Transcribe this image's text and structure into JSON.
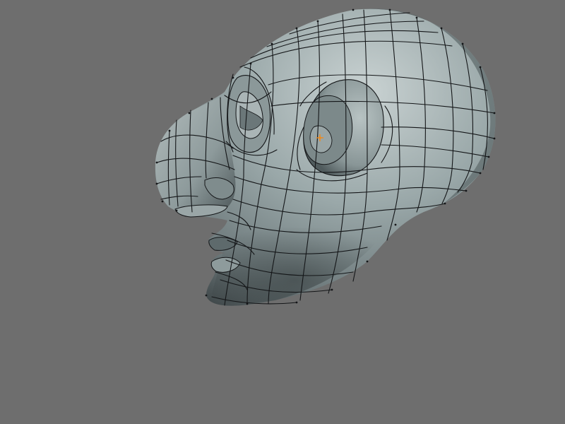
{
  "viewport": {
    "background": "#6e6e6e",
    "mesh_color": "#8c9a9b",
    "shadow_color": "#3f4749",
    "highlight_color": "#c5cfcf",
    "wire_color": "#141618",
    "origin_marker_color": "#f08a1a"
  },
  "object": {
    "description_icon": "monkey-head-subdivision-mesh"
  }
}
